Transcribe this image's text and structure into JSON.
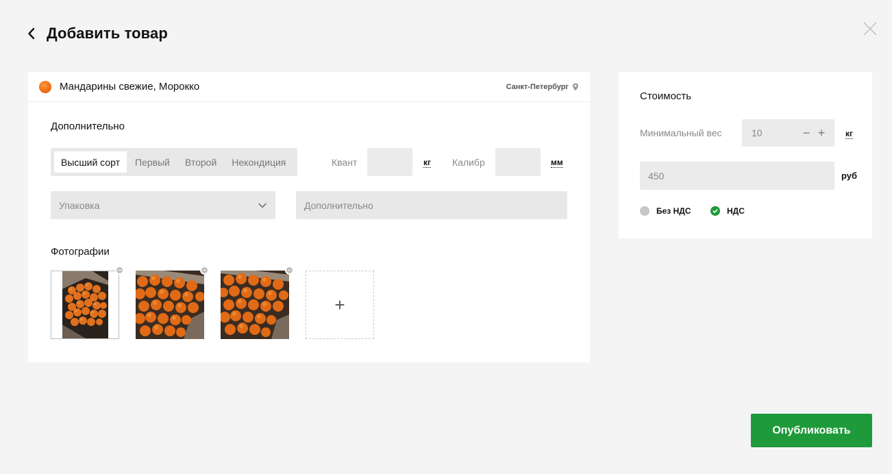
{
  "header": {
    "title": "Добавить товар",
    "back_icon": "chevron-left-icon",
    "close_icon": "close-icon"
  },
  "product": {
    "name": "Мандарины свежие, Морокко",
    "location": "Санкт-Петербург",
    "dot_color": "#f07a1c"
  },
  "additional": {
    "title": "Дополнительно",
    "grades": [
      {
        "label": "Высший сорт",
        "active": true
      },
      {
        "label": "Первый",
        "active": false
      },
      {
        "label": "Второй",
        "active": false
      },
      {
        "label": "Некондиция",
        "active": false
      }
    ],
    "quant_label": "Квант",
    "quant_value": "",
    "quant_unit": "кг",
    "caliber_label": "Калибр",
    "caliber_value": "",
    "caliber_unit": "мм",
    "packaging_placeholder": "Упаковка",
    "extra_placeholder": "Дополнительно"
  },
  "photos": {
    "title": "Фотографии",
    "items": [
      "photo-1",
      "photo-2",
      "photo-3"
    ],
    "add_label": "+"
  },
  "price": {
    "title": "Стоимость",
    "min_weight_label": "Минимальный вес",
    "min_weight_value": "10",
    "min_weight_unit": "кг",
    "price_value": "450",
    "price_unit": "руб",
    "vat_options": [
      {
        "label": "Без НДС",
        "selected": false
      },
      {
        "label": "НДС",
        "selected": true
      }
    ]
  },
  "publish_label": "Опубликовать",
  "colors": {
    "accent": "#1f9a3b",
    "background": "#f4f4f4",
    "orange": "#e8650d"
  }
}
